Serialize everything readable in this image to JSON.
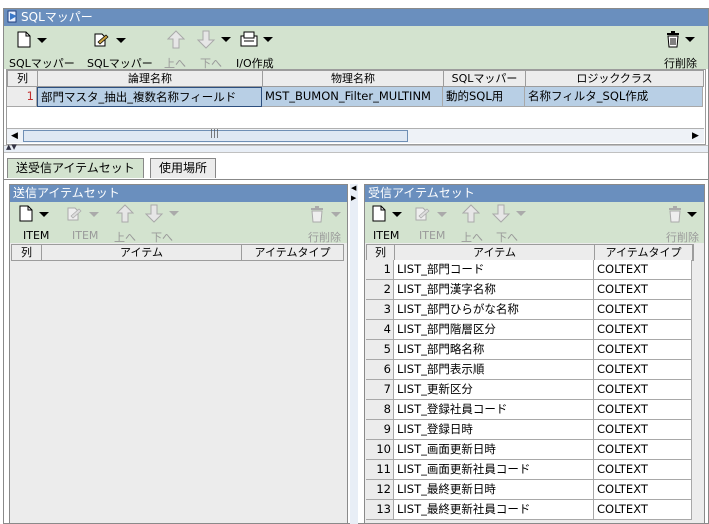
{
  "window": {
    "title": "SQLマッパー"
  },
  "top_toolbar": {
    "labels": [
      "SQLマッパー",
      "SQLマッパー",
      "上へ",
      "下へ",
      "I/O作成",
      "行削除"
    ]
  },
  "mapper_table": {
    "headers": [
      "列",
      "論理名称",
      "物理名称",
      "SQLマッパー",
      "ロジッククラス"
    ],
    "rows": [
      {
        "num": "1",
        "logical": "部門マスタ_抽出_複数名称フィールド",
        "physical": "MST_BUMON_Filter_MULTINM",
        "mapper": "動的SQL用",
        "logic": "名称フィルタ_SQL作成"
      }
    ]
  },
  "tabs": [
    "送受信アイテムセット",
    "使用場所"
  ],
  "send_panel": {
    "title": "送信アイテムセット",
    "toolbar_labels": [
      "ITEM",
      "ITEM",
      "上へ",
      "下へ",
      "行削除"
    ],
    "headers": [
      "列",
      "アイテム",
      "アイテムタイプ"
    ]
  },
  "recv_panel": {
    "title": "受信アイテムセット",
    "toolbar_labels": [
      "ITEM",
      "ITEM",
      "上へ",
      "下へ",
      "行削除"
    ],
    "headers": [
      "列",
      "アイテム",
      "アイテムタイプ"
    ],
    "rows": [
      {
        "num": "1",
        "item": "LIST_部門コード",
        "type": "COLTEXT"
      },
      {
        "num": "2",
        "item": "LIST_部門漢字名称",
        "type": "COLTEXT"
      },
      {
        "num": "3",
        "item": "LIST_部門ひらがな名称",
        "type": "COLTEXT"
      },
      {
        "num": "4",
        "item": "LIST_部門階層区分",
        "type": "COLTEXT"
      },
      {
        "num": "5",
        "item": "LIST_部門略名称",
        "type": "COLTEXT"
      },
      {
        "num": "6",
        "item": "LIST_部門表示順",
        "type": "COLTEXT"
      },
      {
        "num": "7",
        "item": "LIST_更新区分",
        "type": "COLTEXT"
      },
      {
        "num": "8",
        "item": "LIST_登録社員コード",
        "type": "COLTEXT"
      },
      {
        "num": "9",
        "item": "LIST_登録日時",
        "type": "COLTEXT"
      },
      {
        "num": "10",
        "item": "LIST_画面更新日時",
        "type": "COLTEXT"
      },
      {
        "num": "11",
        "item": "LIST_画面更新社員コード",
        "type": "COLTEXT"
      },
      {
        "num": "12",
        "item": "LIST_最終更新日時",
        "type": "COLTEXT"
      },
      {
        "num": "13",
        "item": "LIST_最終更新社員コード",
        "type": "COLTEXT"
      }
    ]
  },
  "scrollbar_grip": "|||",
  "colors": {
    "title_bar": "#6a8fbe",
    "toolbar": "#d3e3cf",
    "selection": "#b8cfe5"
  }
}
